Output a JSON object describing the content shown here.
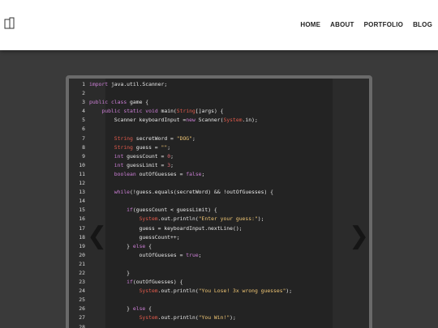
{
  "nav": {
    "items": [
      {
        "label": "HOME"
      },
      {
        "label": "ABOUT"
      },
      {
        "label": "PORTFOLIO"
      },
      {
        "label": "BLOG"
      }
    ]
  },
  "slider": {
    "prev_glyph": "❮",
    "next_glyph": "❯"
  },
  "code": {
    "lines": [
      "import java.util.Scanner;",
      "",
      "public class game {",
      "    public static void main(String[]args) {",
      "        Scanner keyboardInput =new Scanner(System.in);",
      "",
      "        String secretWord = \"DOG\";",
      "        String guess = \"\";",
      "        int guessCount = 0;",
      "        int guessLimit = 3;",
      "        boolean outOfGuesses = false;",
      "",
      "        while(!guess.equals(secretWord) && !outOfGuesses) {",
      "",
      "            if(guessCount < guessLimit) {",
      "                System.out.println(\"Enter your guess:\");",
      "                guess = keyboardInput.nextLine();",
      "                guessCount++;",
      "            } else {",
      "                outOfGuesses = true;",
      "",
      "            }",
      "            if(outOfGuesses) {",
      "                System.out.println(\"You Lose! 3x wrong guesses\");",
      "",
      "            } else {",
      "                System.out.println(\"You Win!\");",
      ""
    ]
  }
}
